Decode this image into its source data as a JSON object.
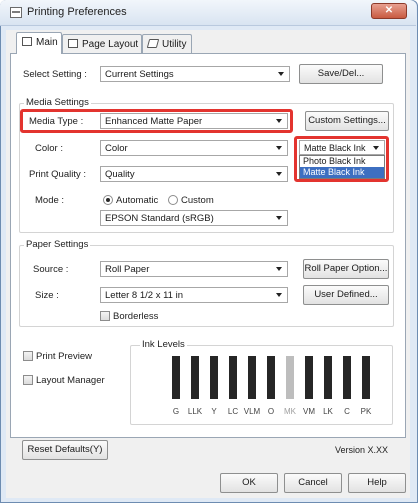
{
  "window": {
    "title": "Printing Preferences",
    "close_label": "✕"
  },
  "tabs": [
    {
      "label": "Main",
      "active": true
    },
    {
      "label": "Page Layout",
      "active": false
    },
    {
      "label": "Utility",
      "active": false
    }
  ],
  "select_setting": {
    "label": "Select Setting :",
    "value": "Current Settings",
    "save_button": "Save/Del..."
  },
  "media_settings": {
    "group_title": "Media Settings",
    "media_type_label": "Media Type :",
    "media_type_value": "Enhanced Matte Paper",
    "custom_settings_button": "Custom Settings...",
    "color_label": "Color :",
    "color_value": "Color",
    "print_quality_label": "Print Quality :",
    "print_quality_value": "Quality",
    "mode_label": "Mode :",
    "mode_automatic": "Automatic",
    "mode_custom": "Custom",
    "color_mode_value": "EPSON Standard (sRGB)",
    "black_ink": {
      "value": "Matte Black Ink",
      "options": [
        "Photo Black Ink",
        "Matte Black Ink"
      ],
      "selected_index": 1
    }
  },
  "paper_settings": {
    "group_title": "Paper Settings",
    "source_label": "Source :",
    "source_value": "Roll Paper",
    "roll_paper_option_button": "Roll Paper Option...",
    "size_label": "Size :",
    "size_value": "Letter 8 1/2 x 11 in",
    "user_defined_button": "User Defined...",
    "borderless_label": "Borderless"
  },
  "print_preview_label": "Print Preview",
  "layout_manager_label": "Layout Manager",
  "ink_levels": {
    "title": "Ink Levels",
    "inks": [
      "G",
      "LLK",
      "Y",
      "LC",
      "VLM",
      "O",
      "MK",
      "VM",
      "LK",
      "C",
      "PK"
    ]
  },
  "footer": {
    "reset_defaults_button": "Reset Defaults(Y)",
    "version": "Version X.XX",
    "ok_button": "OK",
    "cancel_button": "Cancel",
    "help_button": "Help"
  }
}
